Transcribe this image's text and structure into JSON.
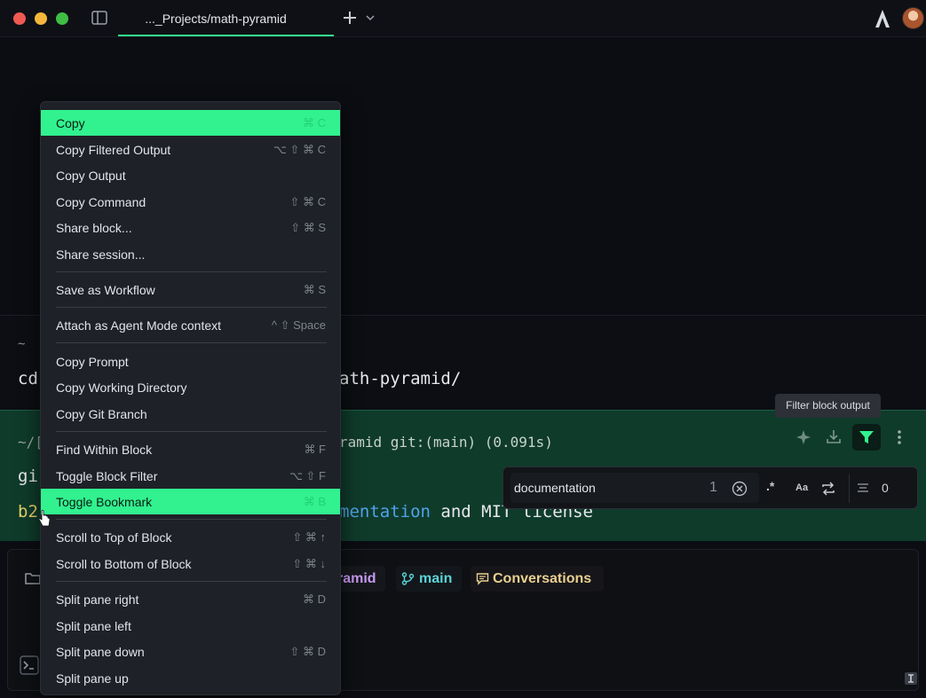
{
  "titlebar": {
    "tab_title": "..._Projects/math-pyramid",
    "accent": "#31e88d"
  },
  "terminal": {
    "block1": {
      "prompt": "~",
      "command_start": "cd",
      "command_end": "ath-pyramid/"
    },
    "block2": {
      "path_start": "~/[",
      "path_end": "ramid git:(main)  (0.091s)",
      "git_cmd": "gi",
      "hash": "b2",
      "msg_keyword": "mentation",
      "msg_rest": " and MIT license",
      "bg": "#0f3b2b"
    },
    "tooltip": "Filter block output",
    "filter_color": "#31f28f"
  },
  "search": {
    "value": "documentation",
    "match_count": "1",
    "regex_label": ".*",
    "case_label": "Aa",
    "total": "0"
  },
  "input": {
    "chips": {
      "dir": "ramid",
      "branch": "main",
      "conversations": "Conversations"
    }
  },
  "menu": {
    "items": [
      {
        "label": "Copy",
        "shortcut": "⌘ C"
      },
      {
        "label": "Copy Filtered Output",
        "shortcut": "⌥ ⇧ ⌘ C"
      },
      {
        "label": "Copy Output",
        "shortcut": ""
      },
      {
        "label": "Copy Command",
        "shortcut": "⇧ ⌘ C"
      },
      {
        "label": "Share block...",
        "shortcut": "⇧ ⌘ S"
      },
      {
        "label": "Share session...",
        "shortcut": ""
      },
      {
        "label": "Save as Workflow",
        "shortcut": "⌘ S"
      },
      {
        "label": "Attach as Agent Mode context",
        "shortcut": "^ ⇧ Space"
      },
      {
        "label": "Copy Prompt",
        "shortcut": ""
      },
      {
        "label": "Copy Working Directory",
        "shortcut": ""
      },
      {
        "label": "Copy Git Branch",
        "shortcut": ""
      },
      {
        "label": "Find Within Block",
        "shortcut": "⌘ F"
      },
      {
        "label": "Toggle Block Filter",
        "shortcut": "⌥ ⇧ F"
      },
      {
        "label": "Toggle Bookmark",
        "shortcut": "⌘ B"
      },
      {
        "label": "Scroll to Top of Block",
        "shortcut": "⇧ ⌘ ↑"
      },
      {
        "label": "Scroll to Bottom of Block",
        "shortcut": "⇧ ⌘ ↓"
      },
      {
        "label": "Split pane right",
        "shortcut": "⌘ D"
      },
      {
        "label": "Split pane left",
        "shortcut": ""
      },
      {
        "label": "Split pane down",
        "shortcut": "⇧ ⌘ D"
      },
      {
        "label": "Split pane up",
        "shortcut": ""
      }
    ],
    "highlight_color": "#31f28f"
  }
}
